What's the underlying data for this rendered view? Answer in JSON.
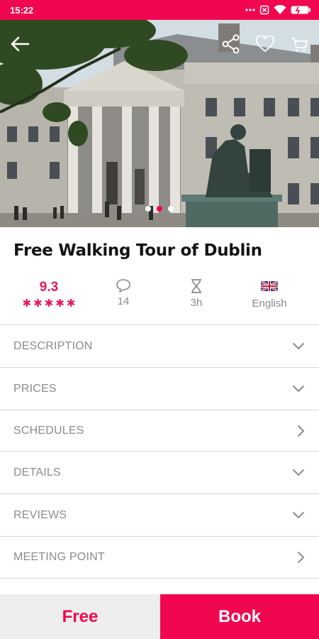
{
  "status_bar": {
    "time": "15:22",
    "icons": [
      "more-dots-icon",
      "sim-off-icon",
      "wifi-icon",
      "battery-icon"
    ]
  },
  "hero": {
    "image_subject": "Trinity College Dublin facade with seated statue",
    "carousel": {
      "count": 3,
      "active_index": 1
    },
    "actions": [
      "back-arrow-icon",
      "share-icon",
      "favorite-heart-icon",
      "cart-icon"
    ]
  },
  "tour": {
    "title": "Free Walking Tour of Dublin"
  },
  "stats": {
    "rating": "9.3",
    "stars": 5,
    "comments": "14",
    "duration": "3h",
    "language": "English"
  },
  "sections": [
    {
      "label": "DESCRIPTION",
      "chevron": "down"
    },
    {
      "label": "PRICES",
      "chevron": "down"
    },
    {
      "label": "SCHEDULES",
      "chevron": "right"
    },
    {
      "label": "DETAILS",
      "chevron": "down"
    },
    {
      "label": "REVIEWS",
      "chevron": "down"
    },
    {
      "label": "MEETING POINT",
      "chevron": "right"
    }
  ],
  "bottom_bar": {
    "price_label": "Free",
    "book_label": "Book"
  },
  "colors": {
    "accent": "#f0074f",
    "muted_text": "#8c8c8c",
    "divider": "#d6d6d6"
  }
}
